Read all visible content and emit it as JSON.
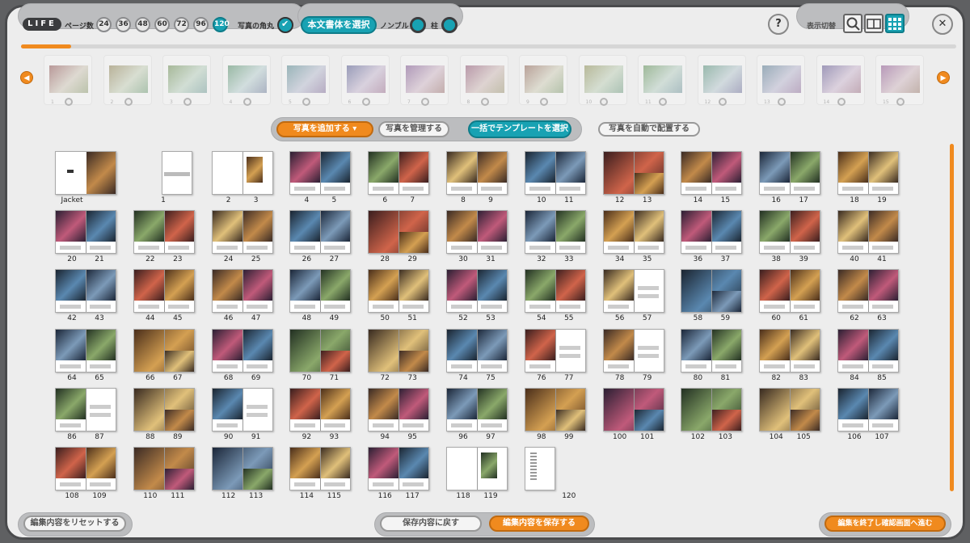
{
  "topbar": {
    "logo": "LIFE",
    "page_count_label": "ページ数",
    "page_counts": [
      "24",
      "36",
      "48",
      "60",
      "72",
      "96",
      "120"
    ],
    "selected_page_count": "120",
    "photo_corner_label": "写真の角丸",
    "font_button": "本文書体を選択",
    "nombre_label": "ノンブル",
    "hashira_label": "柱",
    "help": "?",
    "view_toggle_label": "表示切替",
    "close": "✕"
  },
  "thumbstrip": {
    "numbers": [
      "1",
      "2",
      "3",
      "4",
      "5",
      "6",
      "7",
      "8",
      "9",
      "10",
      "11",
      "12",
      "13",
      "14",
      "15"
    ]
  },
  "actions": {
    "add_photos": "写真を追加する",
    "manage_photos": "写真を管理する",
    "select_templates": "一括でテンプレートを選択",
    "auto_place": "写真を自動で配置する"
  },
  "spreads": [
    {
      "l": "Jacket",
      "r": "",
      "ct": "jacket"
    },
    {
      "l": "1",
      "r": "",
      "ct": "single"
    },
    {
      "l": "2",
      "r": "3",
      "ct": "mostly"
    },
    {
      "l": "4",
      "r": "5",
      "ct": "photo"
    },
    {
      "l": "6",
      "r": "7",
      "ct": "photo"
    },
    {
      "l": "8",
      "r": "9",
      "ct": "photo"
    },
    {
      "l": "10",
      "r": "11",
      "ct": "photo"
    },
    {
      "l": "12",
      "r": "13",
      "ct": "full"
    },
    {
      "l": "14",
      "r": "15",
      "ct": "photo"
    },
    {
      "l": "16",
      "r": "17",
      "ct": "photo"
    },
    {
      "l": "18",
      "r": "19",
      "ct": "photo"
    },
    {
      "l": "20",
      "r": "21",
      "ct": "photo"
    },
    {
      "l": "22",
      "r": "23",
      "ct": "photo"
    },
    {
      "l": "24",
      "r": "25",
      "ct": "photo"
    },
    {
      "l": "26",
      "r": "27",
      "ct": "photo"
    },
    {
      "l": "28",
      "r": "29",
      "ct": "full"
    },
    {
      "l": "30",
      "r": "31",
      "ct": "photo"
    },
    {
      "l": "32",
      "r": "33",
      "ct": "photo"
    },
    {
      "l": "34",
      "r": "35",
      "ct": "photo"
    },
    {
      "l": "36",
      "r": "37",
      "ct": "photo"
    },
    {
      "l": "38",
      "r": "39",
      "ct": "photo"
    },
    {
      "l": "40",
      "r": "41",
      "ct": "photo"
    },
    {
      "l": "42",
      "r": "43",
      "ct": "photo"
    },
    {
      "l": "44",
      "r": "45",
      "ct": "photo"
    },
    {
      "l": "46",
      "r": "47",
      "ct": "photo"
    },
    {
      "l": "48",
      "r": "49",
      "ct": "photo"
    },
    {
      "l": "50",
      "r": "51",
      "ct": "photo"
    },
    {
      "l": "52",
      "r": "53",
      "ct": "photo"
    },
    {
      "l": "54",
      "r": "55",
      "ct": "photo"
    },
    {
      "l": "56",
      "r": "57",
      "ct": "half"
    },
    {
      "l": "58",
      "r": "59",
      "ct": "full"
    },
    {
      "l": "60",
      "r": "61",
      "ct": "photo"
    },
    {
      "l": "62",
      "r": "63",
      "ct": "photo"
    },
    {
      "l": "64",
      "r": "65",
      "ct": "photo"
    },
    {
      "l": "66",
      "r": "67",
      "ct": "full"
    },
    {
      "l": "68",
      "r": "69",
      "ct": "photo"
    },
    {
      "l": "70",
      "r": "71",
      "ct": "full"
    },
    {
      "l": "72",
      "r": "73",
      "ct": "full"
    },
    {
      "l": "74",
      "r": "75",
      "ct": "photo"
    },
    {
      "l": "76",
      "r": "77",
      "ct": "half"
    },
    {
      "l": "78",
      "r": "79",
      "ct": "half"
    },
    {
      "l": "80",
      "r": "81",
      "ct": "photo"
    },
    {
      "l": "82",
      "r": "83",
      "ct": "photo"
    },
    {
      "l": "84",
      "r": "85",
      "ct": "photo"
    },
    {
      "l": "86",
      "r": "87",
      "ct": "half"
    },
    {
      "l": "88",
      "r": "89",
      "ct": "full"
    },
    {
      "l": "90",
      "r": "91",
      "ct": "half"
    },
    {
      "l": "92",
      "r": "93",
      "ct": "photo"
    },
    {
      "l": "94",
      "r": "95",
      "ct": "photo"
    },
    {
      "l": "96",
      "r": "97",
      "ct": "photo"
    },
    {
      "l": "98",
      "r": "99",
      "ct": "full"
    },
    {
      "l": "100",
      "r": "101",
      "ct": "full"
    },
    {
      "l": "102",
      "r": "103",
      "ct": "full"
    },
    {
      "l": "104",
      "r": "105",
      "ct": "full"
    },
    {
      "l": "106",
      "r": "107",
      "ct": "photo"
    },
    {
      "l": "108",
      "r": "109",
      "ct": "photo"
    },
    {
      "l": "110",
      "r": "111",
      "ct": "full"
    },
    {
      "l": "112",
      "r": "113",
      "ct": "full"
    },
    {
      "l": "114",
      "r": "115",
      "ct": "photo"
    },
    {
      "l": "116",
      "r": "117",
      "ct": "photo"
    },
    {
      "l": "118",
      "r": "119",
      "ct": "mostly"
    },
    {
      "l": "",
      "r": "120",
      "ct": "last"
    }
  ],
  "bottom": {
    "reset": "編集内容をリセットする",
    "revert": "保存内容に戻す",
    "save": "編集内容を保存する",
    "finish": "編集を終了し確認画面へ進む"
  },
  "colors": {
    "teal": "#18a2b3",
    "orange": "#f08a1e"
  }
}
